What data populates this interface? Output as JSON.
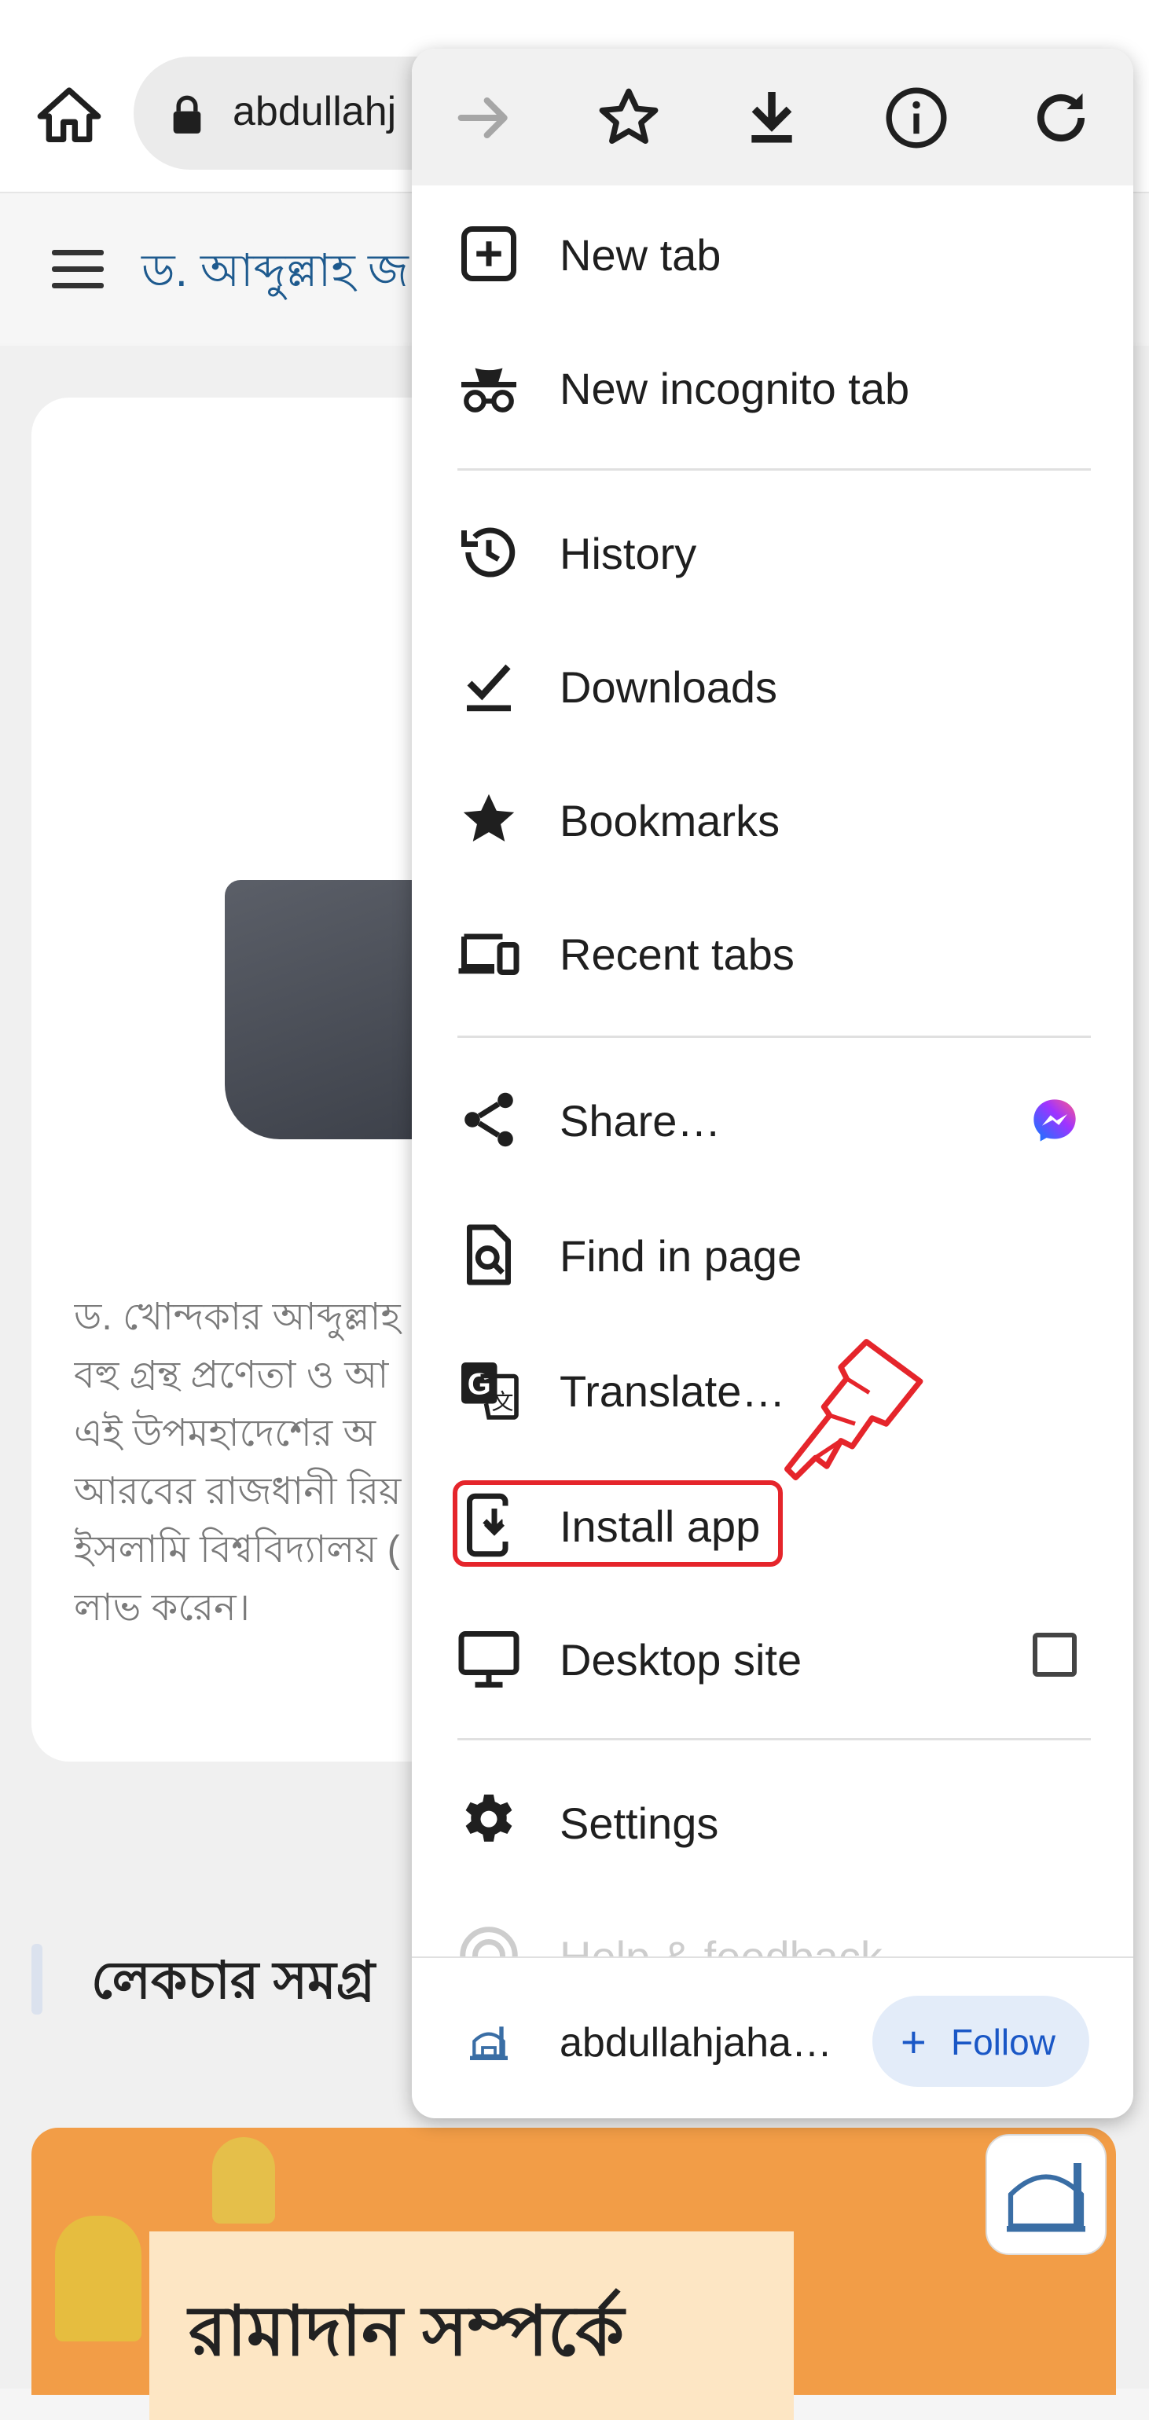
{
  "browser": {
    "url_text": "abdullahj",
    "accent_color": "#1a57c6"
  },
  "page": {
    "site_title": "ড. আব্দুল্লাহ জ",
    "bio_lines": [
      "ড. খোন্দকার আব্দুল্লাহ",
      "বহু গ্রন্থ প্রণেতা ও আ",
      "এই উপমহাদেশের অ",
      "আরবের রাজধানী রিয়",
      "ইসলামি বিশ্ববিদ্যালয় (",
      "লাভ করেন।"
    ],
    "section_title": "লেকচার সমগ্র",
    "banner_text": "রামাদান সম্পর্কে"
  },
  "menu": {
    "toolbar": [
      {
        "name": "forward-icon"
      },
      {
        "name": "bookmark-star-icon"
      },
      {
        "name": "download-icon"
      },
      {
        "name": "info-icon"
      },
      {
        "name": "reload-icon"
      }
    ],
    "items": {
      "new_tab": "New tab",
      "new_incognito_tab": "New incognito tab",
      "history": "History",
      "downloads": "Downloads",
      "bookmarks": "Bookmarks",
      "recent_tabs": "Recent tabs",
      "share": "Share…",
      "find_in_page": "Find in page",
      "translate": "Translate…",
      "install_app": "Install app",
      "desktop_site": "Desktop site",
      "settings": "Settings",
      "help_feedback": "Help & feedback"
    },
    "desktop_site_checked": false,
    "footer": {
      "site_name": "abdullahjaha…",
      "follow_label": "Follow"
    }
  },
  "highlight_color": "#e5252b"
}
